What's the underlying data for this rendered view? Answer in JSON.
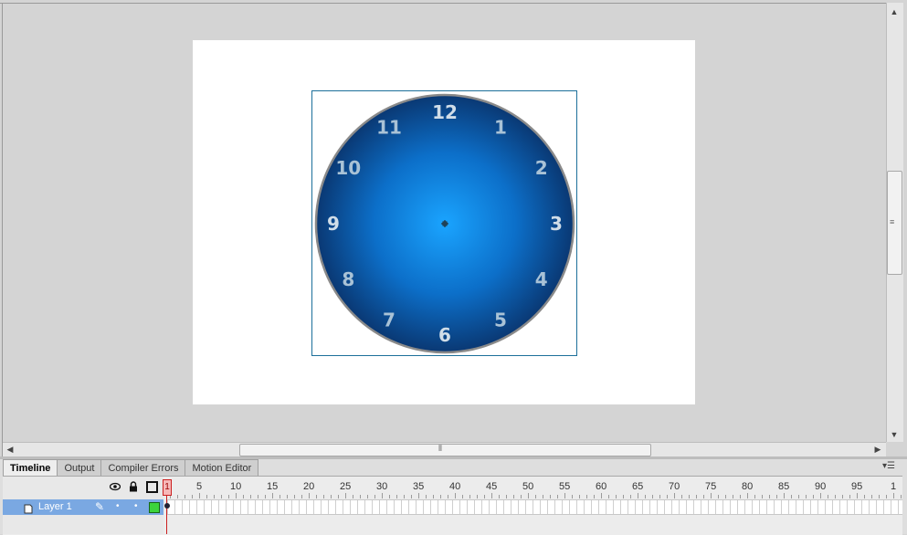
{
  "clock": {
    "numbers": [
      "12",
      "1",
      "2",
      "3",
      "4",
      "5",
      "6",
      "7",
      "8",
      "9",
      "10",
      "11"
    ],
    "face_colors": {
      "center": "#1aa4ff",
      "edge": "#0a3873",
      "rim": "#8a8a8a",
      "numbers": "#a9c2d6"
    }
  },
  "panel": {
    "tabs": [
      {
        "label": "Timeline",
        "active": true
      },
      {
        "label": "Output",
        "active": false
      },
      {
        "label": "Compiler Errors",
        "active": false
      },
      {
        "label": "Motion Editor",
        "active": false
      }
    ],
    "menu_icon": "panel-menu-icon"
  },
  "timeline": {
    "header_icons": [
      "eye-icon",
      "lock-icon",
      "outline-icon"
    ],
    "current_frame": "1",
    "ruler_labels": [
      "5",
      "10",
      "15",
      "20",
      "25",
      "30",
      "35",
      "40",
      "45",
      "50",
      "55",
      "60",
      "65",
      "70",
      "75",
      "80",
      "85",
      "90",
      "95",
      "1"
    ],
    "layers": [
      {
        "name": "Layer 1",
        "color": "#3cd43c",
        "selected": true
      }
    ]
  },
  "colors": {
    "stage_bg": "#ffffff",
    "workspace_bg": "#d4d4d4",
    "selection": "#7aa8e2",
    "playhead": "#cc2020"
  }
}
